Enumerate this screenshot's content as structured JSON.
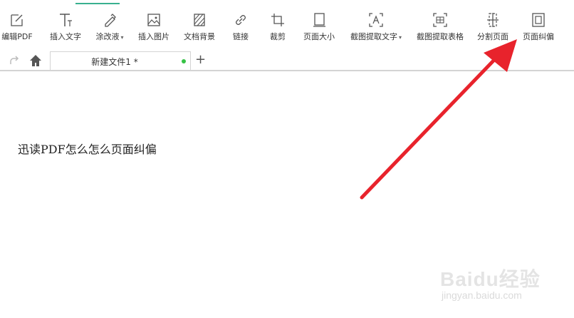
{
  "toolbar": {
    "items": [
      {
        "label": "编辑PDF",
        "icon": "edit-icon"
      },
      {
        "label": "插入文字",
        "icon": "insert-text-icon"
      },
      {
        "label": "涂改液",
        "icon": "correction-pen-icon",
        "has_dropdown": true
      },
      {
        "label": "插入图片",
        "icon": "insert-image-icon"
      },
      {
        "label": "文档背景",
        "icon": "document-background-icon"
      },
      {
        "label": "链接",
        "icon": "link-icon"
      },
      {
        "label": "裁剪",
        "icon": "crop-icon"
      },
      {
        "label": "页面大小",
        "icon": "page-size-icon"
      },
      {
        "label": "截图提取文字",
        "icon": "screenshot-text-icon",
        "has_dropdown": true
      },
      {
        "label": "截图提取表格",
        "icon": "screenshot-table-icon"
      },
      {
        "label": "分割页面",
        "icon": "split-page-icon"
      },
      {
        "label": "页面纠偏",
        "icon": "deskew-page-icon"
      }
    ],
    "active_color": "#39b08f"
  },
  "tabs": {
    "document_tab": {
      "title": "新建文件1 *",
      "status_color": "#35c245"
    },
    "new_tab_label": "+"
  },
  "content": {
    "text": "迅读PDF怎么怎么页面纠偏"
  },
  "annotation": {
    "arrow_color": "#e8232c"
  },
  "watermark": {
    "brand": "Baidu经验",
    "url": "jingyan.baidu.com"
  }
}
